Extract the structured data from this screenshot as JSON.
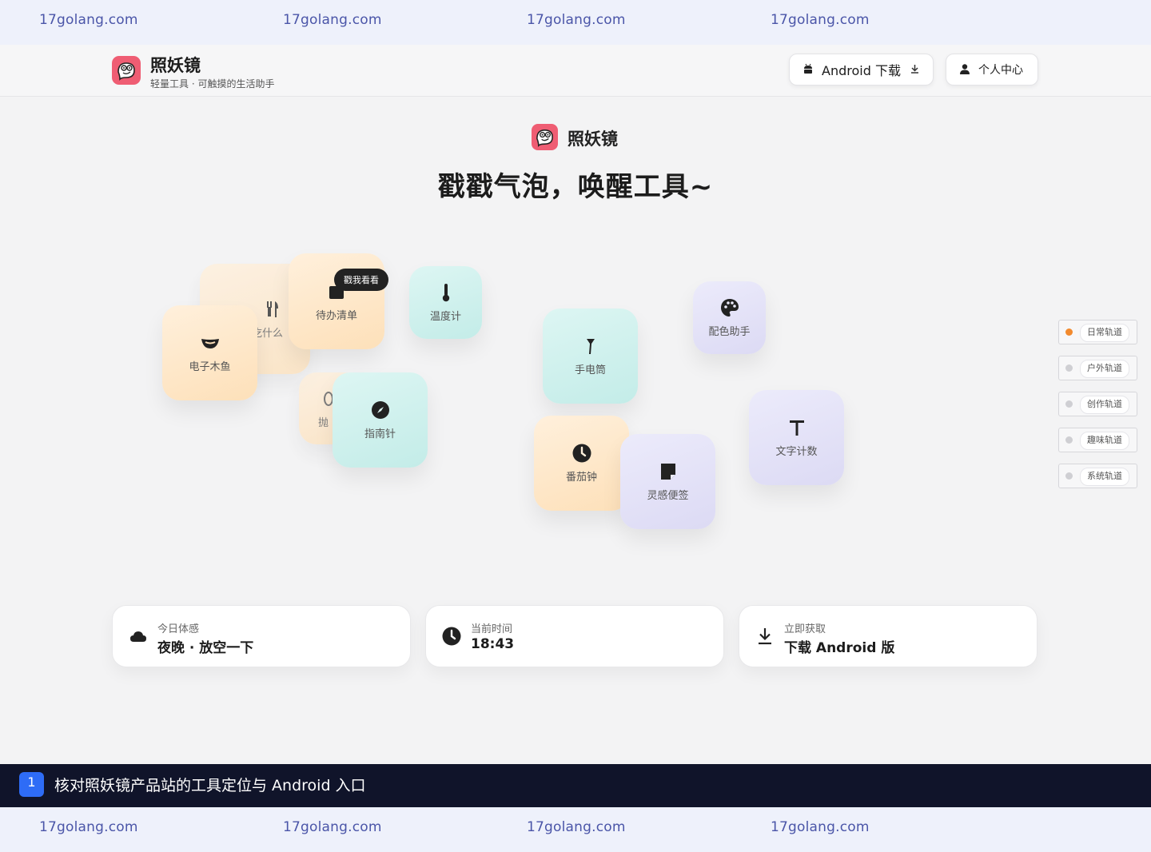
{
  "watermark": {
    "text": "17golang.com"
  },
  "header": {
    "brand_name": "照妖镜",
    "brand_tagline": "轻量工具 · 可触摸的生活助手",
    "android_button": "Android 下载",
    "personal_button": "个人中心"
  },
  "hero": {
    "brand_name": "照妖镜",
    "title": "戳戳气泡，唤醒工具~"
  },
  "bubbles": {
    "what_to_eat": "吃什么",
    "todo": "待办清单",
    "thermometer": "温度计",
    "wooden_fish": "电子木鱼",
    "throw_partial": "抛",
    "compass": "指南针",
    "flashlight": "手电筒",
    "color_helper": "配色助手",
    "text_counter": "文字计数",
    "pomodoro": "番茄钟",
    "inspiration_note": "灵感便签",
    "tooltip": "戳我看看"
  },
  "tracks": [
    {
      "label": "日常轨道",
      "active": true
    },
    {
      "label": "户外轨道",
      "active": false
    },
    {
      "label": "创作轨道",
      "active": false
    },
    {
      "label": "趣味轨道",
      "active": false
    },
    {
      "label": "系统轨道",
      "active": false
    }
  ],
  "cards": {
    "mood": {
      "title": "今日体感",
      "value": "夜晚 · 放空一下"
    },
    "time": {
      "title": "当前时间",
      "value": "18:43"
    },
    "download": {
      "title": "立即获取",
      "value": "下载 Android 版"
    }
  },
  "caption": {
    "number": "1",
    "text": "核对照妖镜产品站的工具定位与 Android 入口"
  },
  "colors": {
    "brand": "#ef5d73",
    "track_active": "#f28a2e",
    "caption_bg": "#10142a",
    "caption_badge": "#2e6cf6"
  }
}
